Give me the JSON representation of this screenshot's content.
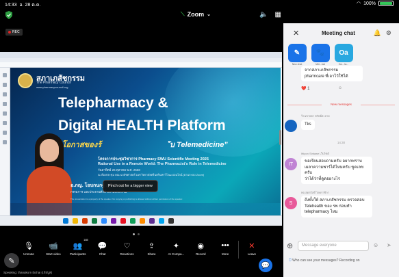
{
  "status_bar": {
    "time": "14:33",
    "date": "อ. 28 ต.ค.",
    "battery": "100%"
  },
  "header": {
    "app_title": "Zoom"
  },
  "recording_badge": "REC",
  "slide": {
    "org_name_th": "สภาเภสัชกรรม",
    "org_name_en": "The Pharmacy Council",
    "org_url": "www.pharmacycouncil.org",
    "title_line1": "Telepharmacy &",
    "title_line2": "Digital HEALTH Platform",
    "quote_th": "“โอกาสของร้",
    "quote_rest": "ับ Telemedicine”",
    "sub1": "โครงการประชุมวิชาการ Pharmacy SWU Scientific Meeting 2025",
    "sub2": "Rational Use in a Remote World: The Pharmacist's Role in Telemedicine",
    "sub3": "วันอาทิตย์ 26 ตุลาคม พ.ศ. 2568",
    "sub4": "ณ ห้องประชุม คณะเภสัชศาสตร์ มหาวิทยาลัยศรีนครินทรวิโรฒ ออนไลน์ (ผ่านระบบ Zoom)",
    "speaker_name": "อ.ภญ. โอบกนกฐ์ ภูมิสายดร",
    "speaker_role": "กรรมการ และประธานศักดิ์ สภาเภสัชกรรม",
    "footer": "The presentation is a property of the speaker. No copying or publishing is allowed without written permission of the speaker."
  },
  "tooltip": "Pinch out for a bigger view",
  "controls": [
    {
      "label": "Unmute",
      "icon": "mic-off-icon",
      "glyph": "🎙"
    },
    {
      "label": "Start video",
      "icon": "video-off-icon",
      "glyph": "📹"
    },
    {
      "label": "Participants",
      "icon": "participants-icon",
      "glyph": "👥",
      "badge": "185"
    },
    {
      "label": "Chat",
      "icon": "chat-icon",
      "glyph": "💬"
    },
    {
      "label": "Reactions",
      "icon": "reactions-icon",
      "glyph": "♡"
    },
    {
      "label": "Share",
      "icon": "share-icon",
      "glyph": "⇪"
    },
    {
      "label": "AI Compa...",
      "icon": "ai-companion-icon",
      "glyph": "✦"
    },
    {
      "label": "Record",
      "icon": "record-icon",
      "glyph": "◉"
    },
    {
      "label": "More",
      "icon": "more-icon",
      "glyph": "•••"
    },
    {
      "label": "Leave",
      "icon": "leave-icon",
      "glyph": "✕"
    }
  ],
  "bottom_left_text": "Speaking: thanakorn ibchai (เก๋ธบูส)",
  "chat": {
    "title": "Meeting chat",
    "tiles": [
      {
        "label": "New chat",
        "glyph": "✎",
        "color": "#1a73e8"
      },
      {
        "label": "Mei...hat",
        "glyph": "🐾",
        "color": "#1a73e8"
      },
      {
        "label": "Oa... ta...",
        "glyph": "Oa",
        "color": "#29a8e0"
      }
    ],
    "messages": [
      {
        "bubble": "จากสภาเภสัชกรรม\npharmcare ที่เอาไว้ใช้ได้",
        "reaction": "❤️  1"
      },
      {
        "divider": "New messages"
      },
      {
        "sender": "ร้านขายยา ทรัพย์สะลาย",
        "avatar": "",
        "avatar_color": "#1565c0",
        "bubble": "Tks"
      },
      {
        "timestamp": "14:30"
      },
      {
        "sender": "Ittipon Sintawe เว็บไซต์",
        "avatar": "IT",
        "avatar_color": "#c084d4",
        "bubble": "ขอเรียนสอบถามครับ อยากทราบ\nเผลาความพาร์ได้ไหมครับ ขูดเลขครับ\nว่าได้ว่าที่ดูดอยางไร"
      },
      {
        "sender": "พฤ สุดสวัสดิ์ โดยราชิกา",
        "avatar": "S",
        "avatar_color": "#e85a9a",
        "bubble": "ถึงทั้งให้ สภาเภสัชกรรม ตรวจสอบ\nTelehealth ของ รพ ก่อนทำ\ntelepharmacy ไหม"
      }
    ],
    "composer_placeholder": "Message everyone",
    "who_can_see": "Who can see your messages? Recording on"
  }
}
